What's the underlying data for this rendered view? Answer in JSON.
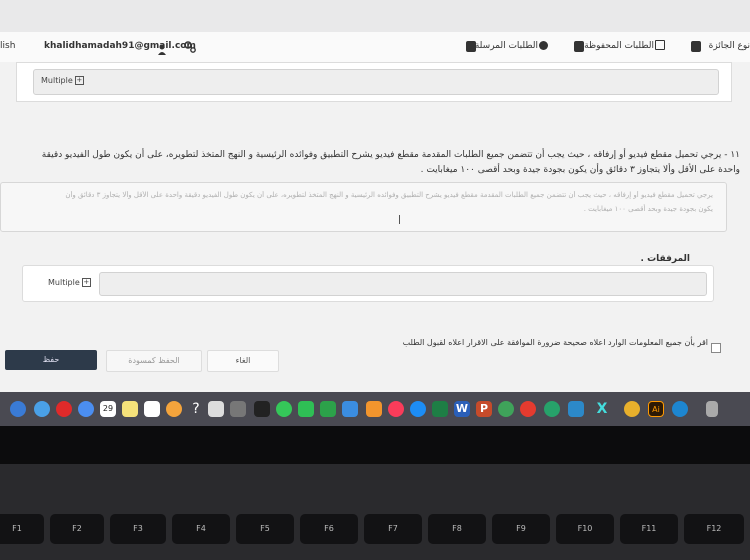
{
  "navbar": {
    "email": "khalidhamadah91@gmail.com",
    "lang_fragment": "lish",
    "sent_requests": "الطلبات المرسلة",
    "saved_requests": "الطلبات المحفوظة",
    "department_type": "نوع الجائزة"
  },
  "top_upload": {
    "multiple_label": "Multiple"
  },
  "question": {
    "line1": "١١ - يرجي تحميل مقطع فيديو أو إرفاقه ، حيث يجب أن تتضمن جميع الطلبات المقدمة مقطع فيديو يشرح التطبيق وفوائده الرئيسية و النهج المتخذ لتطويره، على أن يكون طول الفيديو دقيقة",
    "line2": "واحدة على الأقل وألا يتجاوز ٣ دقائق وأن يكون بجودة جيدة وبحد أقصى ١٠٠ ميغابايت .",
    "placeholder_line1": "يرجي تحميل مقطع فيديو أو إرفاقه ، حيث يجب أن تتضمن جميع الطلبات المقدمة مقطع فيديو يشرح التطبيق وفوائده الرئيسية و النهج المتخذ لتطويره، على أن يكون طول الفيديو دقيقة واحدة على الأقل وألا يتجاوز ٣ دقائق وأن",
    "placeholder_line2": "يكون بجودة جيدة وبحد أقصى ١٠٠ ميغابايت ."
  },
  "attachments": {
    "title": "المرفقات .",
    "multiple_label": "Multiple"
  },
  "agreement": {
    "text": "اقر بأن جميع المعلومات الوارد اعلاه صحيحة ضرورة الموافقة على الاقرار اعلاه لقبول الطلب"
  },
  "buttons": {
    "submit": "حفظ",
    "save_draft": "الحفظ كمسودة",
    "cancel": "الغاء"
  },
  "dock": {
    "calendar_day": "29",
    "icons": [
      "wifi-icon",
      "safari-icon",
      "opera-icon",
      "chrome-icon",
      "calendar-icon",
      "notes-icon",
      "reminders-icon",
      "photos-icon",
      "help-icon",
      "preview-icon",
      "cursor-icon",
      "messages-icon",
      "facetime-icon",
      "numbers-icon",
      "keynote-icon",
      "books-icon",
      "music-icon",
      "appstore-icon",
      "excel-icon",
      "word-icon",
      "powerpoint-icon",
      "globe-icon",
      "opera-icon",
      "camtasia-icon",
      "tools-icon",
      "xcode-icon",
      "chrome-icon",
      "illustrator-icon",
      "edge-icon",
      "trash-icon"
    ],
    "accent": "#ff2d55"
  },
  "keyboard": {
    "keys": [
      "F1",
      "F2",
      "F3",
      "F4",
      "F5",
      "F6",
      "F7",
      "F8",
      "F9",
      "F10",
      "F11",
      "F12"
    ]
  },
  "colors": {
    "submit_bg": "#2d3a4a",
    "page_bg": "#f2f2f2"
  }
}
